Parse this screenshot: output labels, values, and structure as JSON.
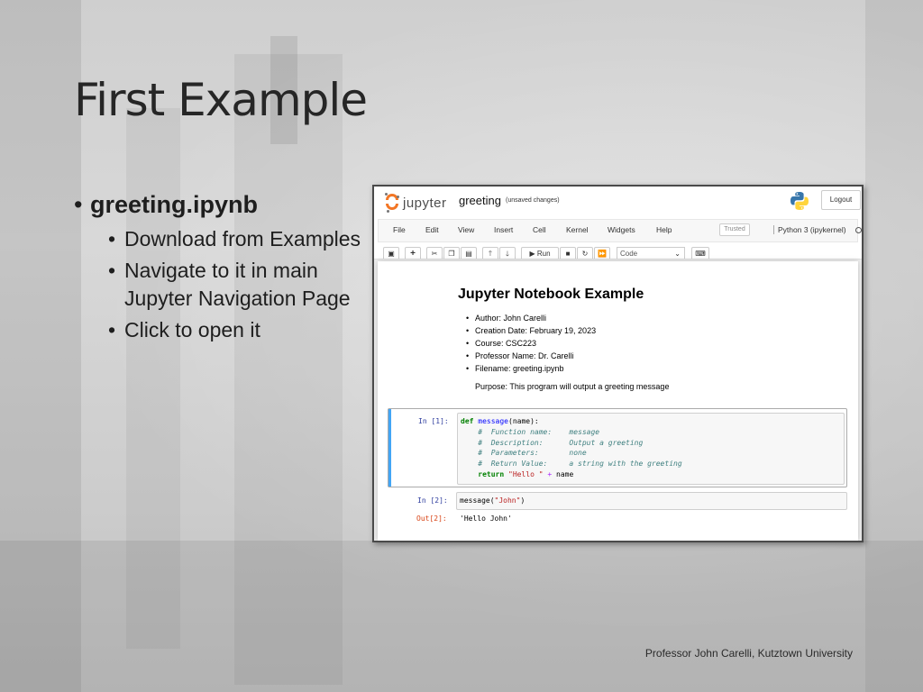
{
  "slide": {
    "title": "First Example",
    "bullet": "greeting.ipynb",
    "sub_bullets": [
      "Download from Examples",
      "Navigate to it in main Jupyter Navigation Page",
      "Click to open it"
    ],
    "footer": "Professor John Carelli,  Kutztown University"
  },
  "notebook": {
    "logo_text": "jupyter",
    "name": "greeting",
    "status": "(unsaved changes)",
    "logout_label": "Logout",
    "menu": [
      "File",
      "Edit",
      "View",
      "Insert",
      "Cell",
      "Kernel",
      "Widgets",
      "Help"
    ],
    "trusted_label": "Trusted",
    "kernel_name": "Python 3 (ipykernel)",
    "toolbar": {
      "run_label": "Run",
      "cell_type": "Code",
      "icons": [
        "save-icon",
        "plus-icon",
        "cut-icon",
        "copy-icon",
        "paste-icon",
        "arrow-up-icon",
        "arrow-down-icon",
        "run-icon",
        "stop-icon",
        "restart-icon",
        "fast-forward-icon",
        "keyboard-icon"
      ]
    },
    "markdown": {
      "title": "Jupyter Notebook Example",
      "items": [
        "Author: John Carelli",
        "Creation Date: February 19, 2023",
        "Course: CSC223",
        "Professor Name: Dr. Carelli",
        "Filename: greeting.ipynb"
      ],
      "purpose": "Purpose: This program will output a greeting message"
    },
    "cell1": {
      "prompt": "In [1]:",
      "code": {
        "def_kw": "def",
        "fn_name": "message",
        "sig": "(name):",
        "comments": [
          "#  Function name:    message",
          "#  Description:      Output a greeting",
          "#  Parameters:       none",
          "#  Return Value:     a string with the greeting"
        ],
        "return_kw": "return",
        "return_str": "\"Hello \"",
        "return_op": "+",
        "return_var": "name"
      }
    },
    "cell2": {
      "prompt": "In [2]:",
      "call_fn": "message(",
      "call_arg": "\"John\"",
      "call_close": ")",
      "out_prompt": "Out[2]:",
      "output": "'Hello John'"
    }
  }
}
